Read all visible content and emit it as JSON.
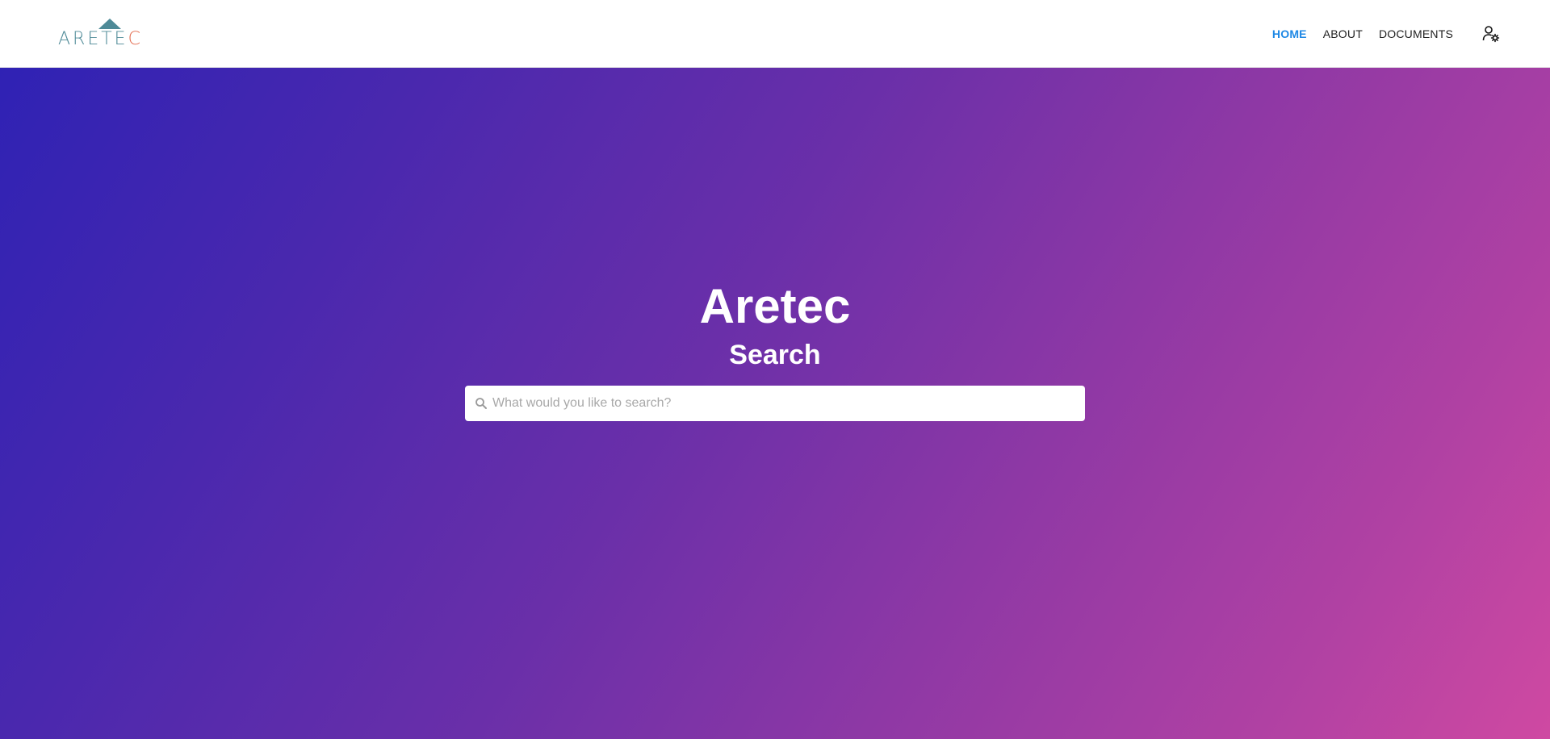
{
  "header": {
    "logo": {
      "text_main": "ARETE",
      "text_accent": "C",
      "colors": {
        "main": "#4e8a97",
        "accent": "#e36c4f"
      }
    },
    "nav": {
      "items": [
        {
          "label": "HOME",
          "active": true
        },
        {
          "label": "ABOUT",
          "active": false
        },
        {
          "label": "DOCUMENTS",
          "active": false
        }
      ],
      "user_icon": "user-settings-icon",
      "active_color": "#1e88e5"
    }
  },
  "hero": {
    "title": "Aretec",
    "subtitle": "Search",
    "gradient_colors": [
      "#2f22b4",
      "#cf49a2"
    ],
    "search": {
      "placeholder": "What would you like to search?",
      "value": "",
      "icon": "search-icon"
    }
  }
}
